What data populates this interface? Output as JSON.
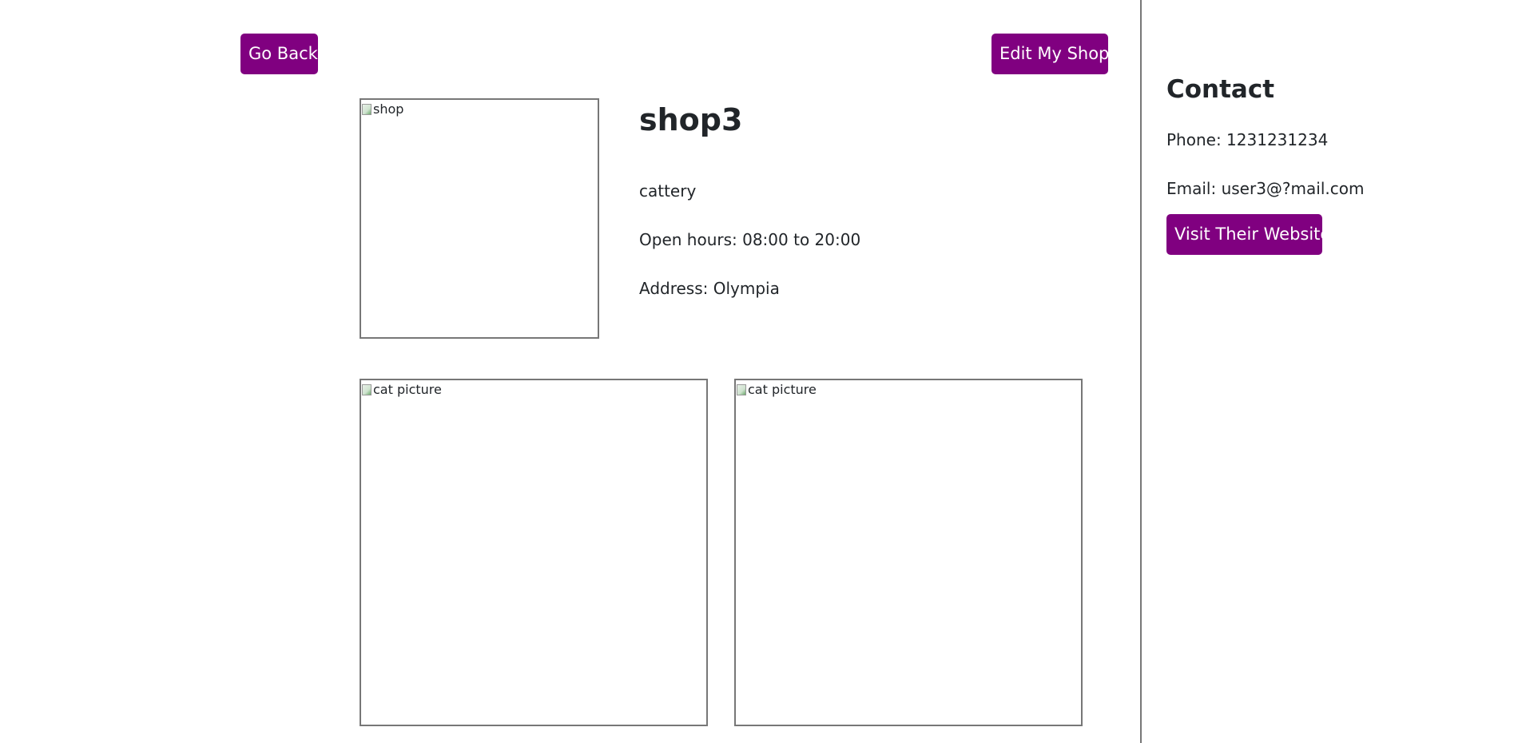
{
  "nav": {
    "go_back_label": "Go Back",
    "edit_shop_label": "Edit My Shop"
  },
  "shop": {
    "image_alt": "shop",
    "name": "shop3",
    "category": "cattery",
    "hours": "Open hours: 08:00 to 20:00",
    "address": "Address: Olympia"
  },
  "gallery": {
    "images": [
      {
        "alt": "cat picture"
      },
      {
        "alt": "cat picture"
      }
    ]
  },
  "contact": {
    "title": "Contact",
    "phone": "Phone: 1231231234",
    "email": "Email: user3@?mail.com",
    "website_button_label": "Visit Their Website"
  },
  "colors": {
    "accent": "#800080",
    "border": "#777777",
    "text": "#212529"
  }
}
